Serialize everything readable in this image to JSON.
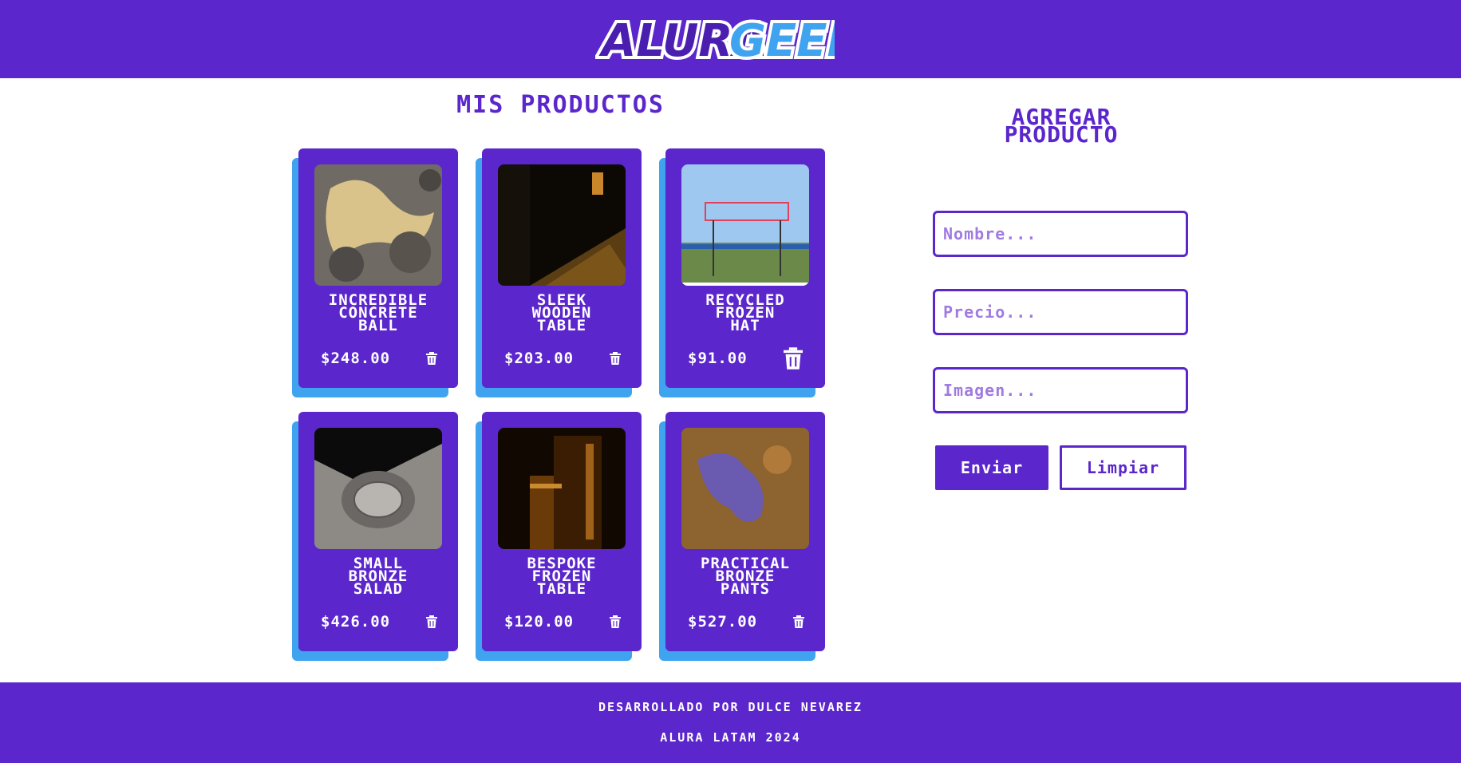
{
  "header": {
    "logo_part1": "ALURA",
    "logo_part2": "GEEK"
  },
  "products_section": {
    "title": "Mis productos"
  },
  "products": [
    {
      "name_lines": [
        "INCREDIBLE",
        "CONCRETE",
        "BALL"
      ],
      "price": "$248.00",
      "image_icon": "rocky-texture-image"
    },
    {
      "name_lines": [
        "SLEEK",
        "WOODEN",
        "TABLE"
      ],
      "price": "$203.00",
      "image_icon": "dark-room-image"
    },
    {
      "name_lines": [
        "RECYCLED",
        "FROZEN",
        "HAT"
      ],
      "price": "$91.00",
      "image_icon": "neon-sign-field-image"
    },
    {
      "name_lines": [
        "SMALL",
        "BRONZE",
        "SALAD"
      ],
      "price": "$426.00",
      "image_icon": "manhole-cover-image"
    },
    {
      "name_lines": [
        "BESPOKE",
        "FROZEN",
        "TABLE"
      ],
      "price": "$120.00",
      "image_icon": "dark-orange-interior-image"
    },
    {
      "name_lines": [
        "PRACTICAL",
        "BRONZE",
        "PANTS"
      ],
      "price": "$527.00",
      "image_icon": "rust-purple-texture-image"
    }
  ],
  "form": {
    "title_line1": "AGREGAR",
    "title_line2": "PRODUCTO",
    "name_placeholder": "Nombre...",
    "price_placeholder": "Precio...",
    "image_placeholder": "Imagen...",
    "send_label": "Enviar",
    "clear_label": "Limpiar"
  },
  "footer": {
    "line1": "Desarrollado por Dulce Nevarez",
    "line2": "Alura Latam 2024"
  },
  "colors": {
    "primary": "#5b27cc",
    "accent": "#3fa3f0",
    "white": "#ffffff"
  }
}
